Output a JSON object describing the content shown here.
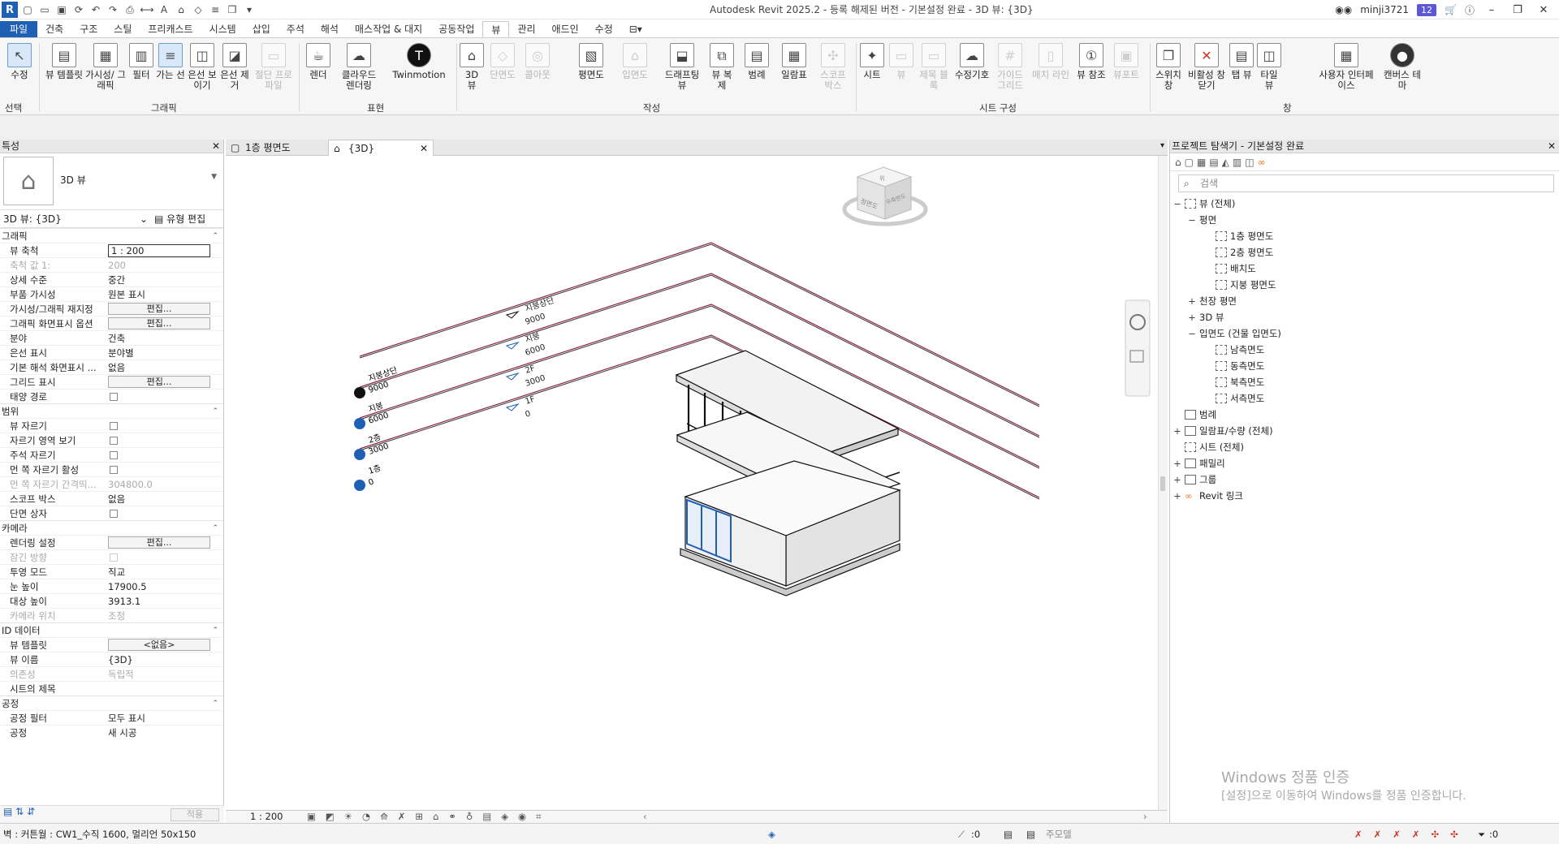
{
  "window": {
    "title": "Autodesk Revit 2025.2 - 등록 해제된 버전 - 기본설정 완료 - 3D 뷰: {3D}",
    "user": "minji3721",
    "notif_count": "12"
  },
  "tabs": [
    "파일",
    "건축",
    "구조",
    "스틸",
    "프리캐스트",
    "시스템",
    "삽입",
    "주석",
    "해석",
    "매스작업 & 대지",
    "공동작업",
    "뷰",
    "관리",
    "애드인",
    "수정"
  ],
  "ribbon": {
    "select": {
      "label": "수정",
      "panel": "선택"
    },
    "graphics": {
      "panel": "그래픽",
      "b1": "뷰 템플릿",
      "b2": "가시성/ 그래픽",
      "b3": "필터",
      "b4": "가는 선",
      "b5": "은선 보이기",
      "b6": "은선 제거",
      "b7": "절단 프로파일"
    },
    "presentation": {
      "panel": "표현",
      "b1": "렌더",
      "b2": "클라우드 렌더링",
      "b3": "Twinmotion"
    },
    "create": {
      "panel": "작성",
      "b1": "3D 뷰",
      "b2": "단면도",
      "b3": "콜아웃",
      "b4": "평면도",
      "b5": "입면도",
      "b6": "드래프팅 뷰",
      "b7": "뷰 복제",
      "b8": "범례",
      "b9": "일람표",
      "b10": "스코프 박스"
    },
    "sheet": {
      "panel": "시트 구성",
      "b1": "시트",
      "b2": "뷰",
      "b3": "제목 블록",
      "b4": "수정기호",
      "b5": "가이드 그리드",
      "b6": "매치 라인",
      "b7": "뷰 참조",
      "b8": "뷰포트"
    },
    "windows": {
      "panel": "창",
      "b1": "스위치 창",
      "b2": "비활성 창 닫기",
      "b3": "탭 뷰",
      "b4": "타일 뷰",
      "b5": "사용자 인터페이스",
      "b6": "캔버스 테마"
    }
  },
  "properties": {
    "title": "특성",
    "type": "3D 뷰",
    "instance": "3D 뷰: {3D}",
    "edit_type": "유형 편집",
    "edit": "편집...",
    "none": "<없음>",
    "apply": "적용",
    "groups": {
      "graphics": {
        "name": "그래픽",
        "rows": [
          [
            "뷰 축척",
            "1 : 200"
          ],
          [
            "축척 값    1:",
            "200"
          ],
          [
            "상세 수준",
            "중간"
          ],
          [
            "부품 가시성",
            "원본 표시"
          ],
          [
            "가시성/그래픽 재지정",
            ""
          ],
          [
            "그래픽 화면표시 옵션",
            ""
          ],
          [
            "분야",
            "건축"
          ],
          [
            "은선 표시",
            "분야별"
          ],
          [
            "기본 해석 화면표시 ...",
            "없음"
          ],
          [
            "그리드 표시",
            ""
          ],
          [
            "태양 경로",
            ""
          ]
        ]
      },
      "extents": {
        "name": "범위",
        "rows": [
          [
            "뷰 자르기",
            ""
          ],
          [
            "자르기 영역 보기",
            ""
          ],
          [
            "주석 자르기",
            ""
          ],
          [
            "먼 쪽 자르기 활성",
            ""
          ],
          [
            "먼 쪽 자르기 간격띄...",
            "304800.0"
          ],
          [
            "스코프 박스",
            "없음"
          ],
          [
            "단면 상자",
            ""
          ]
        ]
      },
      "camera": {
        "name": "카메라",
        "rows": [
          [
            "렌더링 설정",
            ""
          ],
          [
            "잠긴 방향",
            ""
          ],
          [
            "투영 모드",
            "직교"
          ],
          [
            "눈 높이",
            "17900.5"
          ],
          [
            "대상 높이",
            "3913.1"
          ],
          [
            "카메라 위치",
            "조정"
          ]
        ]
      },
      "identity": {
        "name": "ID 데이터",
        "rows": [
          [
            "뷰 템플릿",
            ""
          ],
          [
            "뷰 이름",
            "{3D}"
          ],
          [
            "의존성",
            "독립적"
          ],
          [
            "시트의 제목",
            ""
          ]
        ]
      },
      "phasing": {
        "name": "공정",
        "rows": [
          [
            "공정 필터",
            "모두 표시"
          ],
          [
            "공정",
            "새 시공"
          ]
        ]
      }
    }
  },
  "view_tabs": [
    "1층 평면도",
    "{3D}"
  ],
  "levels": {
    "left": [
      {
        "name": "지붕상단",
        "elev": "9000"
      },
      {
        "name": "지붕",
        "elev": "6000"
      },
      {
        "name": "2층",
        "elev": "3000"
      },
      {
        "name": "1층",
        "elev": "0"
      }
    ],
    "right": [
      {
        "name": "지붕상단",
        "elev": "9000"
      },
      {
        "name": "지붕",
        "elev": "6000"
      },
      {
        "name": "2F",
        "elev": "3000"
      },
      {
        "name": "1F",
        "elev": "0"
      }
    ]
  },
  "viewcube": {
    "front": "정면도",
    "right": "우측면도",
    "top": "위"
  },
  "view_scale": "1 : 200",
  "browser": {
    "title": "프로젝트 탐색기 - 기본설정 완료",
    "search": "검색",
    "n_views": "뷰 (전체)",
    "n_plans": "평면",
    "n_plan1": "1층 평면도",
    "n_plan2": "2층 평면도",
    "n_site": "배치도",
    "n_roof": "지붕 평면도",
    "n_ceiling": "천장 평면",
    "n_3d": "3D 뷰",
    "n_elev": "입면도 (건물 입면도)",
    "n_south": "남측면도",
    "n_east": "동측면도",
    "n_north": "북측면도",
    "n_west": "서측면도",
    "n_legend": "범례",
    "n_sched": "일람표/수량 (전체)",
    "n_sheets": "시트 (전체)",
    "n_family": "패밀리",
    "n_groups": "그룹",
    "n_links": "Revit 링크"
  },
  "status": {
    "text": "벽 : 커튼월 : CW1_수직 1600, 멀리언 50x150",
    "zero": ":0",
    "model": "주모델",
    "filter_count": ":0"
  },
  "watermark": {
    "l1": "Windows 정품 인증",
    "l2": "[설정]으로 이동하여 Windows를 정품 인증합니다."
  },
  "colors": {
    "accent": "#1f5fb4",
    "grid": "#8b2340"
  }
}
